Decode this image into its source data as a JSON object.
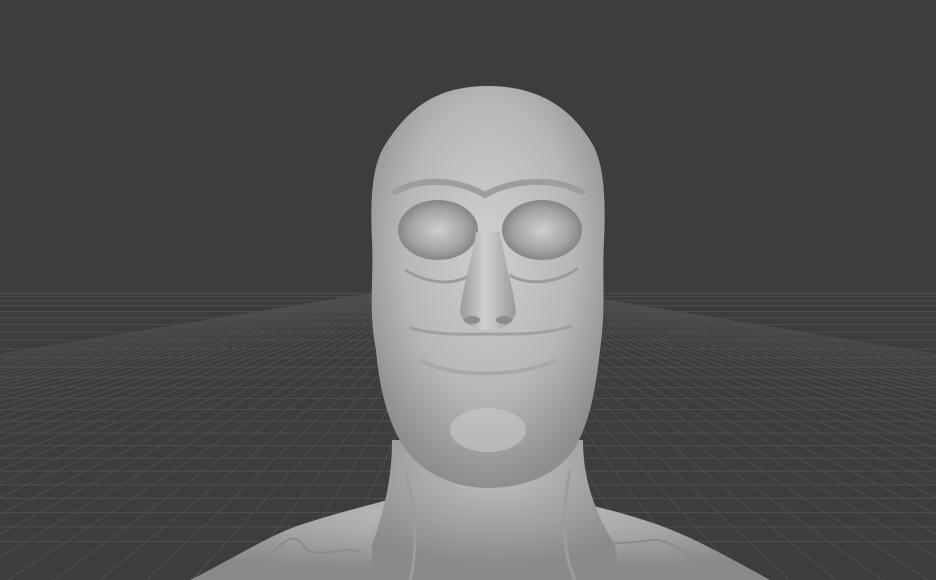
{
  "viewport": {
    "background_color": "#3d3d3d",
    "grid_color": "#4e4e4e",
    "model_color": "#bfbfbf",
    "model": "sculpted-head-bust"
  }
}
